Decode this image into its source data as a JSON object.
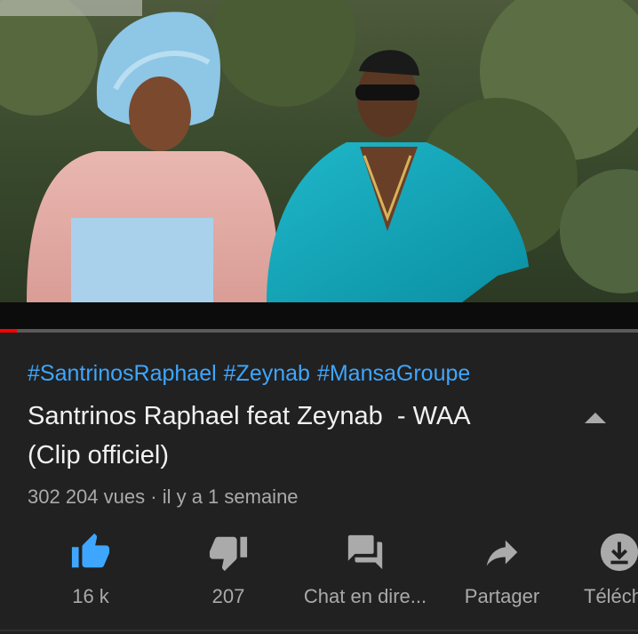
{
  "video": {
    "progress_fraction": 0.026
  },
  "description": {
    "hashtags": [
      "#SantrinosRaphael",
      "#Zeynab",
      "#MansaGroupe"
    ],
    "title": "Santrinos Raphael feat Zeynab  - WAA\n(Clip officiel)",
    "views": "302 204 vues",
    "separator": "·",
    "age": "il y a 1 semaine"
  },
  "actions": {
    "like": {
      "label": "16 k",
      "icon": "thumbs-up-icon",
      "color": "#3ea6ff"
    },
    "dislike": {
      "label": "207",
      "icon": "thumbs-down-icon"
    },
    "chat": {
      "label": "Chat en dire...",
      "icon": "chat-icon"
    },
    "share": {
      "label": "Partager",
      "icon": "share-icon"
    },
    "download": {
      "label": "Téléch",
      "icon": "download-icon"
    }
  },
  "colors": {
    "background": "#212121",
    "hashtag": "#3ea6ff",
    "progress": "#ff0000",
    "text_primary": "#f1f1f1",
    "text_secondary": "#aaaaaa"
  }
}
